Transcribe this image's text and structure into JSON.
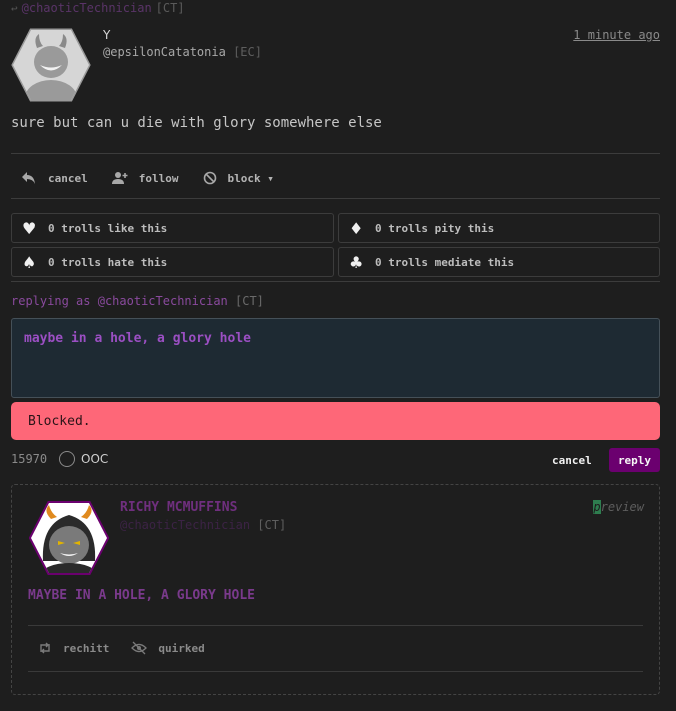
{
  "context": {
    "arrow": "↩",
    "handle": "@chaoticTechnician",
    "abbr": "[CT]"
  },
  "post": {
    "author_name": "Y",
    "author_handle": "@epsilonCatatonia",
    "author_abbr": "[EC]",
    "timestamp": "1 minute ago",
    "body": "sure but can u die with glory somewhere else",
    "avatar_icon": "grinning-troll-avatar-icon"
  },
  "actions": [
    {
      "label": "cancel",
      "icon": "reply-arrow-icon"
    },
    {
      "label": "follow",
      "icon": "add-user-icon"
    },
    {
      "label": "block ▾",
      "icon": "block-icon"
    }
  ],
  "reactions": {
    "like": {
      "glyph": "♥",
      "label": "0 trolls like this"
    },
    "pity": {
      "glyph": "♦",
      "label": "0 trolls pity this"
    },
    "hate": {
      "glyph": "♠",
      "label": "0 trolls hate this"
    },
    "mediate": {
      "glyph": "♣",
      "label": "0 trolls mediate this"
    }
  },
  "reply": {
    "replying_prefix": "replying as",
    "handle": "@chaoticTechnician",
    "abbr": "[CT]",
    "text": "maybe in a hole, a glory hole",
    "alert": "Blocked.",
    "char_count": "15970",
    "ooc_label": "OOC",
    "cancel_label": "cancel",
    "submit_label": "reply"
  },
  "preview": {
    "name": "RICHY MCMUFFINS",
    "handle": "@chaoticTechnician",
    "abbr": "[CT]",
    "label_first": "p",
    "label_rest": "review",
    "body": "MAYBE IN A HOLE, A GLORY HOLE",
    "actions": [
      {
        "label": "rechitt",
        "icon": "repost-icon"
      },
      {
        "label": "quirked",
        "icon": "eye-slash-icon"
      }
    ]
  },
  "colors": {
    "background": "#1e1e1e",
    "accent_purple": "#6b006f",
    "alert_red": "#fe6778",
    "reply_text": "#9b4fc3"
  }
}
